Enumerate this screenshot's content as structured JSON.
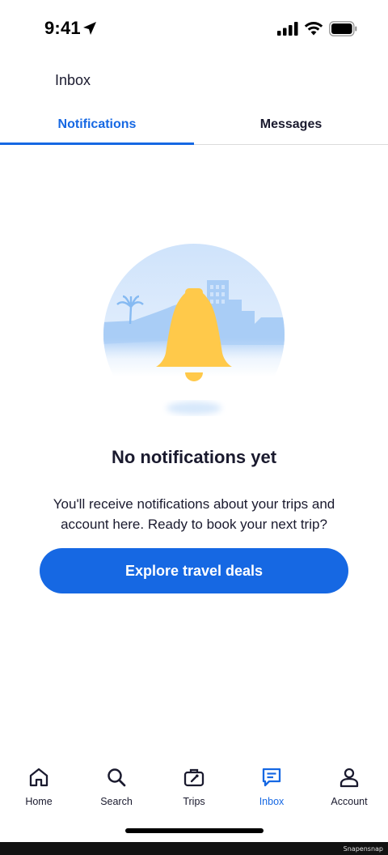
{
  "status_bar": {
    "time": "9:41"
  },
  "header": {
    "title": "Inbox"
  },
  "tabs": [
    {
      "label": "Notifications",
      "active": true
    },
    {
      "label": "Messages",
      "active": false
    }
  ],
  "empty_state": {
    "title": "No notifications yet",
    "body": "You'll receive notifications about your trips and account here. Ready to book your next trip?",
    "cta_label": "Explore travel deals",
    "illustration_icon": "bell-icon"
  },
  "bottom_nav": [
    {
      "label": "Home",
      "icon": "home-icon",
      "active": false
    },
    {
      "label": "Search",
      "icon": "search-icon",
      "active": false
    },
    {
      "label": "Trips",
      "icon": "suitcase-icon",
      "active": false
    },
    {
      "label": "Inbox",
      "icon": "message-icon",
      "active": true
    },
    {
      "label": "Account",
      "icon": "person-icon",
      "active": false
    }
  ],
  "watermark": "Snapensnap",
  "colors": {
    "accent": "#1668e3",
    "text": "#1a1a2e",
    "bell": "#ffc94a",
    "sky": "#cfe3fb"
  }
}
